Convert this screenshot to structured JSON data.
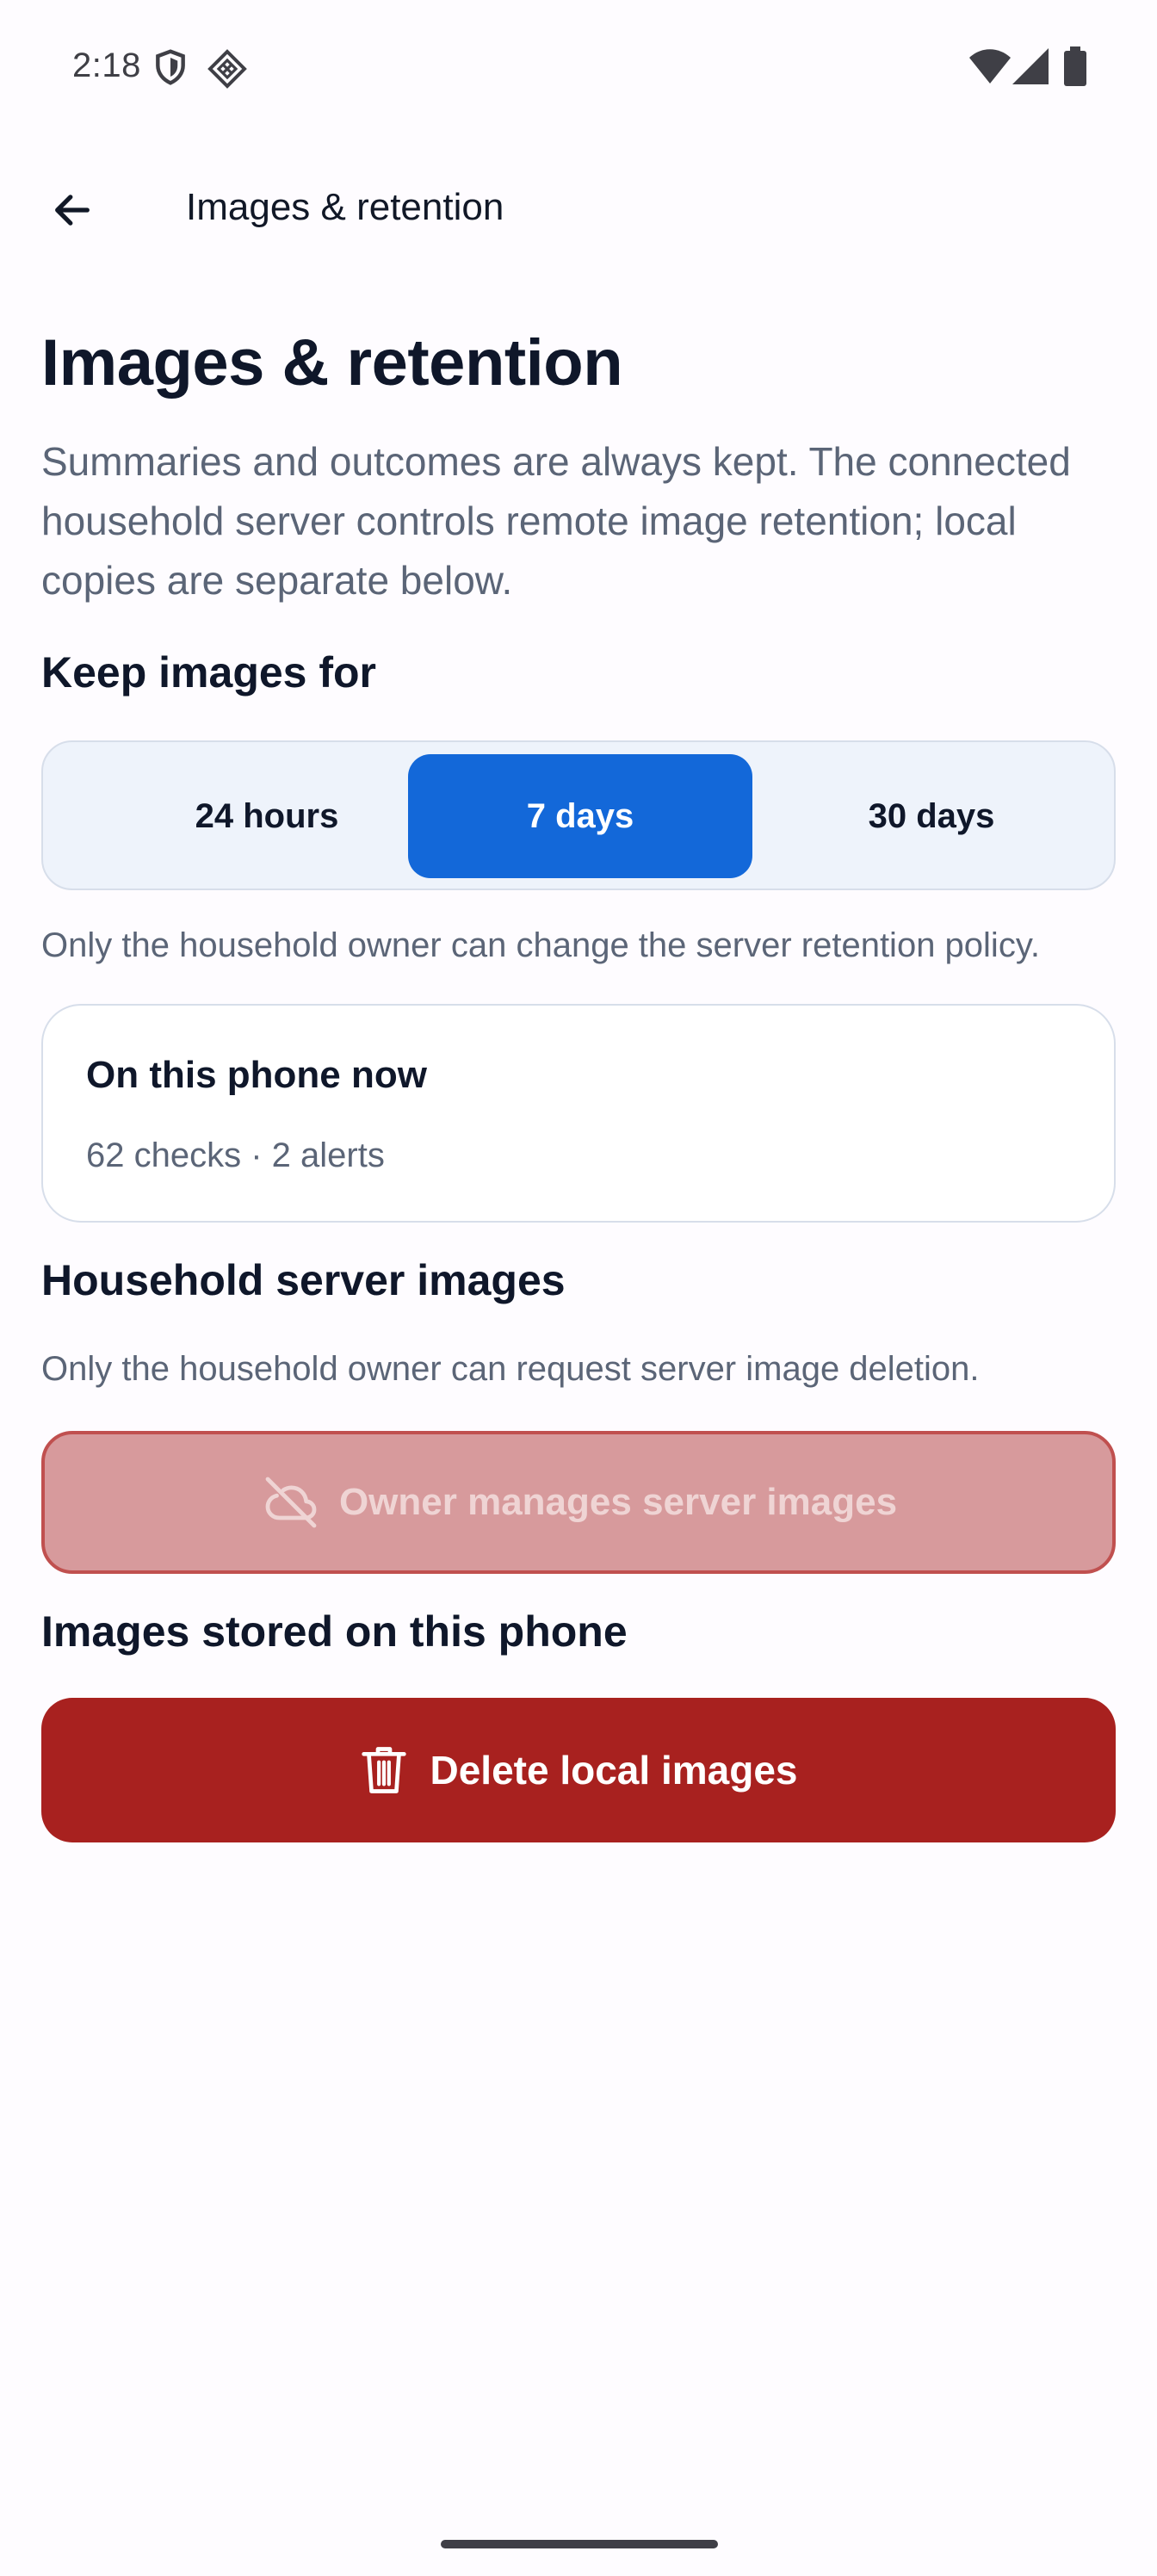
{
  "status_bar": {
    "time": "2:18",
    "icons": [
      "shield-icon",
      "diamond-grid-icon",
      "wifi-icon",
      "cell-signal-icon",
      "battery-icon"
    ]
  },
  "app_bar": {
    "back_icon": "arrow-left-icon",
    "title": "Images & retention"
  },
  "main": {
    "title": "Images & retention",
    "intro": "Summaries and outcomes are always kept. The connected household server controls remote image retention; local copies are separate below.",
    "keep_images": {
      "heading": "Keep images for",
      "options": [
        "24 hours",
        "7 days",
        "30 days"
      ],
      "selected": "7 days",
      "note": "Only the household owner can change the server retention policy."
    },
    "phone_card": {
      "title": "On this phone now",
      "detail": "62 checks · 2 alerts"
    },
    "server_images": {
      "heading": "Household server images",
      "note": "Only the household owner can request server image deletion.",
      "button_label": "Owner manages server images",
      "button_icon": "cloud-off-icon",
      "button_enabled": false
    },
    "local_images": {
      "heading": "Images stored on this phone",
      "button_label": "Delete local images",
      "button_icon": "trash-icon"
    }
  },
  "colors": {
    "accent": "#1368d9",
    "danger": "#a8211f",
    "danger_disabled": "#d79a9c",
    "muted_text": "#5b6577"
  }
}
